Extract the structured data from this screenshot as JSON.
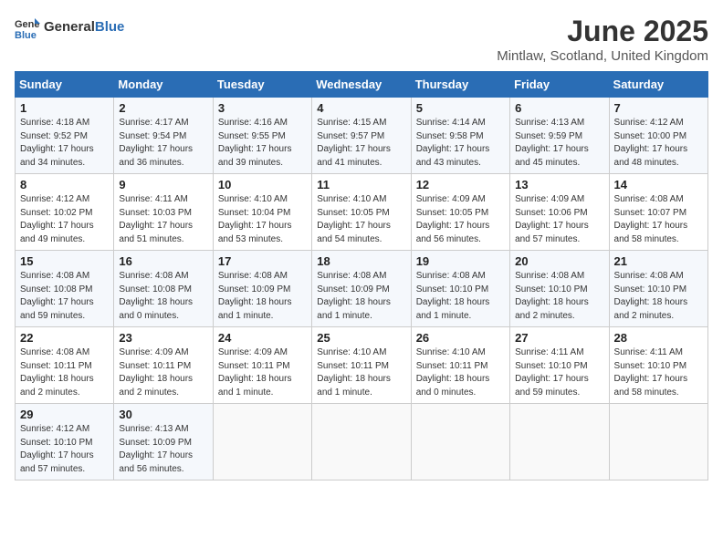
{
  "header": {
    "logo_general": "General",
    "logo_blue": "Blue",
    "month_title": "June 2025",
    "location": "Mintlaw, Scotland, United Kingdom"
  },
  "days_of_week": [
    "Sunday",
    "Monday",
    "Tuesday",
    "Wednesday",
    "Thursday",
    "Friday",
    "Saturday"
  ],
  "weeks": [
    [
      {
        "day": 1,
        "sunrise": "4:18 AM",
        "sunset": "9:52 PM",
        "daylight": "17 hours and 34 minutes."
      },
      {
        "day": 2,
        "sunrise": "4:17 AM",
        "sunset": "9:54 PM",
        "daylight": "17 hours and 36 minutes."
      },
      {
        "day": 3,
        "sunrise": "4:16 AM",
        "sunset": "9:55 PM",
        "daylight": "17 hours and 39 minutes."
      },
      {
        "day": 4,
        "sunrise": "4:15 AM",
        "sunset": "9:57 PM",
        "daylight": "17 hours and 41 minutes."
      },
      {
        "day": 5,
        "sunrise": "4:14 AM",
        "sunset": "9:58 PM",
        "daylight": "17 hours and 43 minutes."
      },
      {
        "day": 6,
        "sunrise": "4:13 AM",
        "sunset": "9:59 PM",
        "daylight": "17 hours and 45 minutes."
      },
      {
        "day": 7,
        "sunrise": "4:12 AM",
        "sunset": "10:00 PM",
        "daylight": "17 hours and 48 minutes."
      }
    ],
    [
      {
        "day": 8,
        "sunrise": "4:12 AM",
        "sunset": "10:02 PM",
        "daylight": "17 hours and 49 minutes."
      },
      {
        "day": 9,
        "sunrise": "4:11 AM",
        "sunset": "10:03 PM",
        "daylight": "17 hours and 51 minutes."
      },
      {
        "day": 10,
        "sunrise": "4:10 AM",
        "sunset": "10:04 PM",
        "daylight": "17 hours and 53 minutes."
      },
      {
        "day": 11,
        "sunrise": "4:10 AM",
        "sunset": "10:05 PM",
        "daylight": "17 hours and 54 minutes."
      },
      {
        "day": 12,
        "sunrise": "4:09 AM",
        "sunset": "10:05 PM",
        "daylight": "17 hours and 56 minutes."
      },
      {
        "day": 13,
        "sunrise": "4:09 AM",
        "sunset": "10:06 PM",
        "daylight": "17 hours and 57 minutes."
      },
      {
        "day": 14,
        "sunrise": "4:08 AM",
        "sunset": "10:07 PM",
        "daylight": "17 hours and 58 minutes."
      }
    ],
    [
      {
        "day": 15,
        "sunrise": "4:08 AM",
        "sunset": "10:08 PM",
        "daylight": "17 hours and 59 minutes."
      },
      {
        "day": 16,
        "sunrise": "4:08 AM",
        "sunset": "10:08 PM",
        "daylight": "18 hours and 0 minutes."
      },
      {
        "day": 17,
        "sunrise": "4:08 AM",
        "sunset": "10:09 PM",
        "daylight": "18 hours and 1 minute."
      },
      {
        "day": 18,
        "sunrise": "4:08 AM",
        "sunset": "10:09 PM",
        "daylight": "18 hours and 1 minute."
      },
      {
        "day": 19,
        "sunrise": "4:08 AM",
        "sunset": "10:10 PM",
        "daylight": "18 hours and 1 minute."
      },
      {
        "day": 20,
        "sunrise": "4:08 AM",
        "sunset": "10:10 PM",
        "daylight": "18 hours and 2 minutes."
      },
      {
        "day": 21,
        "sunrise": "4:08 AM",
        "sunset": "10:10 PM",
        "daylight": "18 hours and 2 minutes."
      }
    ],
    [
      {
        "day": 22,
        "sunrise": "4:08 AM",
        "sunset": "10:11 PM",
        "daylight": "18 hours and 2 minutes."
      },
      {
        "day": 23,
        "sunrise": "4:09 AM",
        "sunset": "10:11 PM",
        "daylight": "18 hours and 2 minutes."
      },
      {
        "day": 24,
        "sunrise": "4:09 AM",
        "sunset": "10:11 PM",
        "daylight": "18 hours and 1 minute."
      },
      {
        "day": 25,
        "sunrise": "4:10 AM",
        "sunset": "10:11 PM",
        "daylight": "18 hours and 1 minute."
      },
      {
        "day": 26,
        "sunrise": "4:10 AM",
        "sunset": "10:11 PM",
        "daylight": "18 hours and 0 minutes."
      },
      {
        "day": 27,
        "sunrise": "4:11 AM",
        "sunset": "10:10 PM",
        "daylight": "17 hours and 59 minutes."
      },
      {
        "day": 28,
        "sunrise": "4:11 AM",
        "sunset": "10:10 PM",
        "daylight": "17 hours and 58 minutes."
      }
    ],
    [
      {
        "day": 29,
        "sunrise": "4:12 AM",
        "sunset": "10:10 PM",
        "daylight": "17 hours and 57 minutes."
      },
      {
        "day": 30,
        "sunrise": "4:13 AM",
        "sunset": "10:09 PM",
        "daylight": "17 hours and 56 minutes."
      },
      null,
      null,
      null,
      null,
      null
    ]
  ]
}
